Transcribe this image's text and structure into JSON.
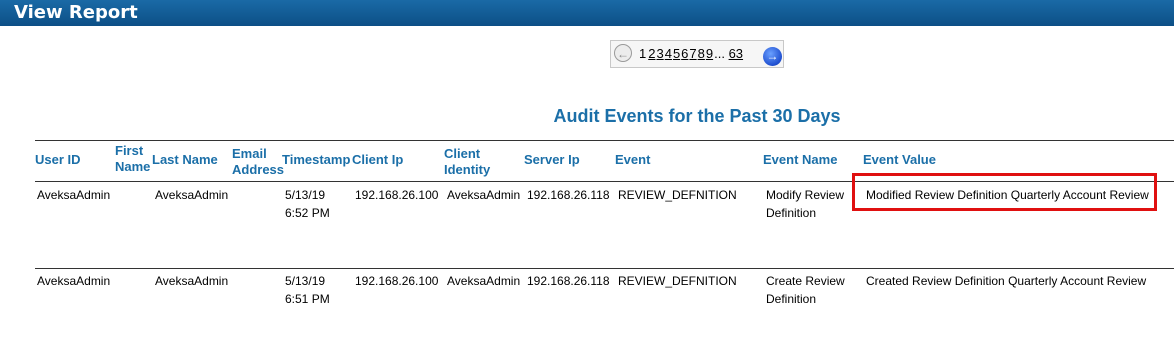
{
  "window": {
    "title": "View Report"
  },
  "pager": {
    "prev_icon": "arrow-left-circle-icon",
    "next_icon": "arrow-right-circle-icon",
    "current_page": "1",
    "pages": [
      "2",
      "3",
      "4",
      "5",
      "6",
      "7",
      "8",
      "9"
    ],
    "ellipsis": "...",
    "last_page": "63"
  },
  "report": {
    "title": "Audit Events for the Past 30 Days"
  },
  "table": {
    "columns": [
      "User ID",
      "First Name",
      "Last Name",
      "Email Address",
      "Timestamp",
      "Client Ip",
      "Client Identity",
      "Server Ip",
      "Event",
      "Event Name",
      "Event Value"
    ],
    "column_lines": {
      "first_name": [
        "First",
        "Name"
      ],
      "email_address": [
        "Email",
        "Address"
      ],
      "client_identity": [
        "Client",
        "Identity"
      ]
    },
    "rows": [
      {
        "user_id": "AveksaAdmin",
        "first_name": "",
        "last_name": "AveksaAdmin",
        "email_address": "",
        "timestamp": [
          "5/13/19",
          "6:52 PM"
        ],
        "client_ip": "192.168.26.100",
        "client_identity": "AveksaAdmin",
        "server_ip": "192.168.26.118",
        "event": "REVIEW_DEFNITION",
        "event_name": [
          "Modify Review",
          "Definition"
        ],
        "event_value": "Modified Review Definition Quarterly Account Review",
        "highlighted": true
      },
      {
        "user_id": "AveksaAdmin",
        "first_name": "",
        "last_name": "AveksaAdmin",
        "email_address": "",
        "timestamp": [
          "5/13/19",
          "6:51 PM"
        ],
        "client_ip": "192.168.26.100",
        "client_identity": "AveksaAdmin",
        "server_ip": "192.168.26.118",
        "event": "REVIEW_DEFNITION",
        "event_name": [
          "Create Review",
          "Definition"
        ],
        "event_value": "Created Review Definition Quarterly Account Review",
        "highlighted": false
      }
    ]
  },
  "colors": {
    "titlebar": "#0c4f86",
    "header_text": "#1b6fa8",
    "highlight_border": "#e01010"
  }
}
